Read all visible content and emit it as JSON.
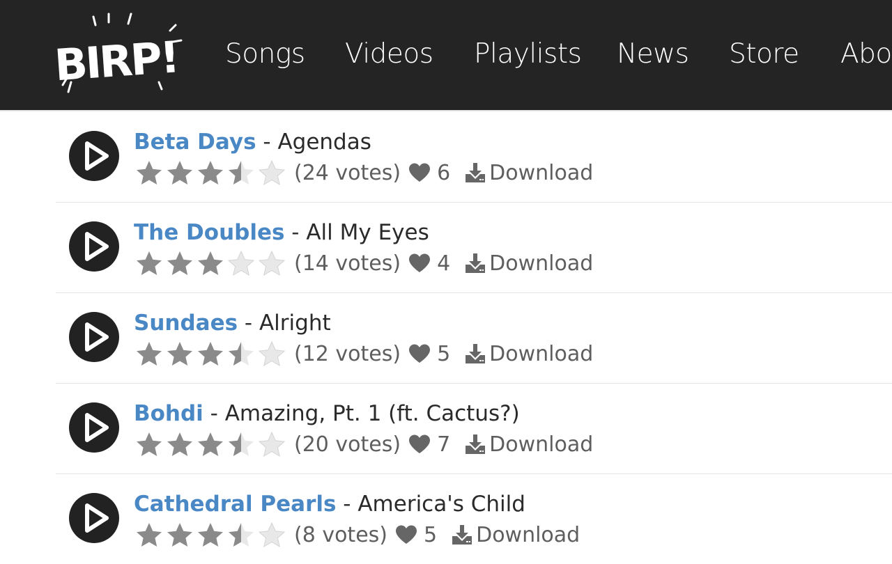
{
  "header": {
    "logo_text": "BIRP!",
    "nav": [
      {
        "label": "Songs"
      },
      {
        "label": "Videos"
      },
      {
        "label": "Playlists"
      },
      {
        "label": "News"
      },
      {
        "label": "Store"
      },
      {
        "label": "Abo"
      }
    ]
  },
  "icons": {
    "play": "play-icon",
    "star": "star-icon",
    "heart": "heart-icon",
    "download": "download-icon"
  },
  "colors": {
    "nav_bg": "#242424",
    "artist_link": "#4a88c5",
    "star_filled": "#8a8a8a",
    "star_empty": "#e8e8e8",
    "meta_text": "#5e5e5e"
  },
  "songs": [
    {
      "artist": "Beta Days",
      "separator": " - ",
      "title": "Agendas",
      "rating": 3.5,
      "votes": "(24 votes)",
      "likes": "6",
      "download_label": "Download"
    },
    {
      "artist": "The Doubles",
      "separator": " - ",
      "title": "All My Eyes",
      "rating": 3,
      "votes": "(14 votes)",
      "likes": "4",
      "download_label": "Download"
    },
    {
      "artist": "Sundaes",
      "separator": " - ",
      "title": "Alright",
      "rating": 3.5,
      "votes": "(12 votes)",
      "likes": "5",
      "download_label": "Download"
    },
    {
      "artist": "Bohdi",
      "separator": " - ",
      "title": "Amazing, Pt. 1 (ft. Cactus?)",
      "rating": 3.5,
      "votes": "(20 votes)",
      "likes": "7",
      "download_label": "Download"
    },
    {
      "artist": "Cathedral Pearls",
      "separator": " - ",
      "title": "America's Child",
      "rating": 3.5,
      "votes": "(8 votes)",
      "likes": "5",
      "download_label": "Download"
    }
  ]
}
